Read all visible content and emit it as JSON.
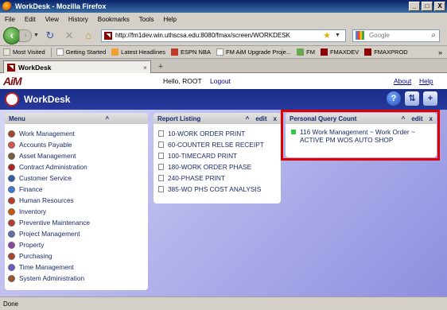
{
  "window": {
    "title": "WorkDesk - Mozilla Firefox",
    "buttons": [
      "_",
      "□",
      "X"
    ]
  },
  "menubar": [
    "File",
    "Edit",
    "View",
    "History",
    "Bookmarks",
    "Tools",
    "Help"
  ],
  "nav": {
    "url": "http://fm1dev.win.uthscsa.edu:8080/fmax/screen/WORKDESK",
    "search_placeholder": "Google"
  },
  "bookmarks": [
    "Most Visited",
    "Getting Started",
    "Latest Headlines",
    "ESPN NBA",
    "FM AiM Upgrade Proje...",
    "FM",
    "FMAXDEV",
    "FMAXPROD"
  ],
  "tab": {
    "title": "WorkDesk"
  },
  "app": {
    "logo": "AiM",
    "greeting": "Hello, ROOT",
    "logout": "Logout",
    "about": "About",
    "help": "Help",
    "workdesk_title": "WorkDesk"
  },
  "menu_panel": {
    "title": "Menu",
    "collapse": "^",
    "items": [
      "Work Management",
      "Accounts Payable",
      "Asset Management",
      "Contract Administration",
      "Customer Service",
      "Finance",
      "Human Resources",
      "Inventory",
      "Preventive Maintenance",
      "Project Management",
      "Property",
      "Purchasing",
      "Time Management",
      "System Administration"
    ],
    "icon_colors": [
      "#b0412b",
      "#d9534f",
      "#7a5c3c",
      "#b22222",
      "#2f5ea8",
      "#3a7bd5",
      "#c0392b",
      "#d35400",
      "#c0392b",
      "#5b6eae",
      "#8e44ad",
      "#b0412b",
      "#6a5acd",
      "#a0522d"
    ]
  },
  "report_panel": {
    "title": "Report Listing",
    "collapse": "^",
    "edit": "edit",
    "close": "x",
    "items": [
      "10-WORK ORDER PRINT",
      "60-COUNTER RELSE RECEIPT",
      "100-TIMECARD PRINT",
      "180-WORK ORDER PHASE",
      "240-PHASE PRINT",
      "385-WO PHS COST ANALYSIS"
    ]
  },
  "pq_panel": {
    "title": "Personal Query Count",
    "collapse": "^",
    "edit": "edit",
    "close": "x",
    "item_line1": "116 Work Management ~ Work Order ~",
    "item_line2": "ACTIVE PM WOS AUTO SHOP"
  },
  "status": "Done"
}
